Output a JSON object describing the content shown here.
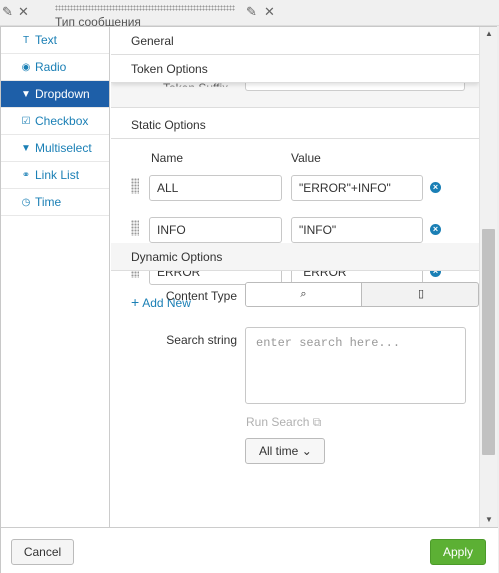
{
  "background": {
    "title": "Тип сообщения",
    "edit_icon": "pencil-icon",
    "close_icon": "close-icon"
  },
  "nav": {
    "items": [
      {
        "label": "Text",
        "icon": "text-icon",
        "glyph": "T",
        "active": false
      },
      {
        "label": "Radio",
        "icon": "radio-icon",
        "glyph": "◉",
        "active": false
      },
      {
        "label": "Dropdown",
        "icon": "caret-down-icon",
        "glyph": "▼",
        "active": true
      },
      {
        "label": "Checkbox",
        "icon": "checkbox-icon",
        "glyph": "☑",
        "active": false
      },
      {
        "label": "Multiselect",
        "icon": "caret-down-icon",
        "glyph": "▼",
        "active": false
      },
      {
        "label": "Link List",
        "icon": "link-icon",
        "glyph": "🔗",
        "active": false
      },
      {
        "label": "Time",
        "icon": "clock-icon",
        "glyph": "◷",
        "active": false
      }
    ]
  },
  "sections": {
    "general": "General",
    "token_options": "Token Options",
    "token_label_partial": "Token Suffix",
    "static_options": "Static Options",
    "dynamic_options": "Dynamic Options"
  },
  "static": {
    "name_header": "Name",
    "value_header": "Value",
    "rows": [
      {
        "name": "ALL",
        "value": "\"ERROR\"+INFO\""
      },
      {
        "name": "INFO",
        "value": "\"INFO\""
      },
      {
        "name": "ERROR",
        "value": "\"ERROR\""
      }
    ],
    "add_new": "Add New"
  },
  "dynamic": {
    "content_type_label": "Content Type",
    "search_string_label": "Search string",
    "search_placeholder": "enter search here...",
    "run_search": "Run Search",
    "time_button": "All time"
  },
  "footer": {
    "cancel": "Cancel",
    "apply": "Apply"
  },
  "colors": {
    "accent": "#1a7fb5",
    "active_nav": "#1e5fa8",
    "apply_green": "#5cb034"
  }
}
